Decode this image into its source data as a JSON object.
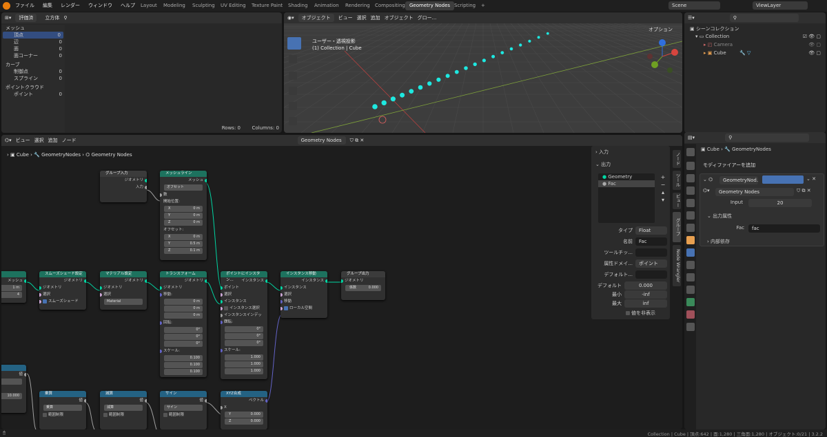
{
  "menus": [
    "ファイル",
    "編集",
    "レンダー",
    "ウィンドウ",
    "ヘルプ"
  ],
  "workspaces": [
    "Layout",
    "Modeling",
    "Sculpting",
    "UV Editing",
    "Texture Paint",
    "Shading",
    "Animation",
    "Rendering",
    "Compositing",
    "Geometry Nodes",
    "Scripting"
  ],
  "scene": "Scene",
  "view_layer": "ViewLayer",
  "spreadsheet": {
    "mode": "評価済",
    "object": "立方体",
    "items": [
      {
        "label": "メッシュ",
        "count": ""
      },
      {
        "label": "頂点",
        "count": "0"
      },
      {
        "label": "辺",
        "count": "0"
      },
      {
        "label": "面",
        "count": "0"
      },
      {
        "label": "面コーナー",
        "count": "0"
      },
      {
        "label": "カーブ",
        "count": ""
      },
      {
        "label": "制御点",
        "count": "0"
      },
      {
        "label": "スプライン",
        "count": "0"
      },
      {
        "label": "ポイントクラウド",
        "count": ""
      },
      {
        "label": "ポイント",
        "count": "0"
      }
    ],
    "rows": "Rows: 0",
    "cols": "Columns: 0"
  },
  "viewport": {
    "mode": "オブジェクト",
    "menu": [
      "ビュー",
      "選択",
      "追加",
      "オブジェクト"
    ],
    "transform": "グロー...",
    "title": "ユーザー・透視投影",
    "subtitle": "(1) Collection | Cube",
    "options": "オプション"
  },
  "outliner": {
    "root": "シーンコレクション",
    "collection": "Collection",
    "camera": "Camera",
    "cube": "Cube"
  },
  "node_editor": {
    "menu": [
      "ビュー",
      "選択",
      "追加",
      "ノード"
    ],
    "tree": "Geometry Nodes",
    "breadcrumb": [
      "Cube",
      "GeometryNodes",
      "Geometry Nodes"
    ]
  },
  "nodes": {
    "group_input": {
      "title": "グループ入力",
      "out1": "ジオメトリ",
      "out2": "入力"
    },
    "mesh_line": {
      "title": "メッシュライン",
      "out": "メッシュ",
      "mode": "オフセット",
      "count": "数",
      "start": "開始位置:",
      "sx": "0 m",
      "sy": "0 m",
      "sz": "0 m",
      "offset": "オフセット:",
      "ox": "0 m",
      "oy": "0.5 m",
      "oz": "0.1 m",
      "x": "X",
      "y": "Y",
      "z": "Z"
    },
    "smooth": {
      "title": "スムーズシェード設定",
      "out": "ジオメトリ",
      "in1": "ジオメトリ",
      "in2": "選択",
      "in3": "スムーズシェード"
    },
    "material": {
      "title": "マテリアル設定",
      "out": "ジオメトリ",
      "in1": "ジオメトリ",
      "in2": "選択",
      "mat": "Material"
    },
    "transform": {
      "title": "トランスフォーム",
      "out": "ジオメトリ",
      "in1": "ジオメトリ",
      "move": "移動:",
      "mx": "0 m",
      "my": "0 m",
      "mz": "0 m",
      "rot": "回転:",
      "rx": "0°",
      "ry": "0°",
      "rz": "0°",
      "scale": "スケール:",
      "scx": "0.100",
      "scy": "0.100",
      "scz": "0.100"
    },
    "inst_pts": {
      "title": "ポイントにインスタン...",
      "out": "インスタンス",
      "in1": "ポイント",
      "in2": "選択",
      "in3": "インスタンス",
      "in4": "インスタンス選択",
      "in5": "インスタンスインデック",
      "rot": "回転:",
      "rx": "0°",
      "ry": "0°",
      "rz": "0°",
      "scale": "スケール:",
      "scx": "1.000",
      "scy": "1.000",
      "scz": "1.000"
    },
    "translate": {
      "title": "インスタンス移動",
      "out": "インスタンス",
      "in1": "インスタンス",
      "in2": "選択",
      "in3": "移動",
      "in4": "ローカル空間"
    },
    "group_output": {
      "title": "グループ出力",
      "in1": "ジオメトリ",
      "fac": "係数",
      "facv": "0.000"
    },
    "left_mesh": {
      "out": "メッシュ",
      "v1": "1 m",
      "v2": "4"
    },
    "mult": {
      "title": "乗算",
      "out": "値",
      "mode": "乗算",
      "clamp": "範囲制限"
    },
    "sub": {
      "title": "減算",
      "out": "値",
      "mode": "減算",
      "clamp": "範囲制限"
    },
    "sine": {
      "title": "サイン",
      "out": "値",
      "mode": "サイン",
      "clamp": "範囲制限"
    },
    "combine": {
      "title": "XYZ合成",
      "out": "ベクトル",
      "x": "X",
      "y": "Y",
      "yv": "0.000",
      "z": "Z",
      "zv": "0.000"
    },
    "left_val": {
      "out": "値",
      "v": "10.000"
    }
  },
  "npanel": {
    "inputs": "入力",
    "outputs": "出力",
    "out_list": [
      "Geometry",
      "Fac"
    ],
    "type_l": "タイプ",
    "type_v": "Float",
    "name_l": "名前",
    "name_v": "Fac",
    "tip_l": "ツールチッ...",
    "attr_l": "属性ドメイ...",
    "attr_v": "ポイント",
    "def_l": "デフォルト...",
    "default_l": "デフォルト",
    "default_v": "0.000",
    "min_l": "最小",
    "min_v": "-inf",
    "max_l": "最大",
    "max_v": "inf",
    "hide": "値を非表示"
  },
  "ntabs": [
    "ノード",
    "ツール",
    "ビュー",
    "グループ",
    "Node Wrangler"
  ],
  "props": {
    "object": "Cube",
    "modifier": "GeometryNodes",
    "add": "モディファイアーを追加",
    "mod_name": "GeometryNod...",
    "tree": "Geometry Nodes",
    "input_l": "Input",
    "input_v": "20",
    "out_attr": "出力属性",
    "fac_l": "Fac",
    "fac_v": "fac",
    "deps": "内部依存"
  },
  "status": "Collection | Cube | 頂点:642 | 面:1,280 | 三角面:1,280 | オブジェクト:0/21 | 3.2.2"
}
